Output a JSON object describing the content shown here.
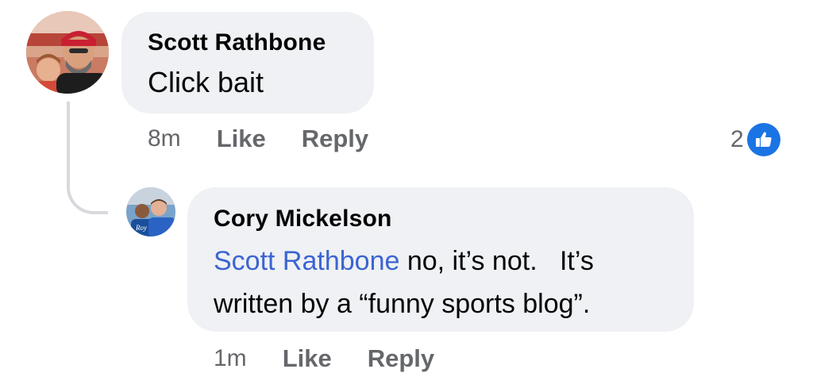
{
  "comments": [
    {
      "author": "Scott Rathbone",
      "text": "Click bait",
      "time": "8m",
      "like_label": "Like",
      "reply_label": "Reply",
      "reaction_count": "2",
      "reaction_icon": "thumbs-up-icon",
      "avatar": "profile-photo-scott-rathbone"
    },
    {
      "author": "Cory Mickelson",
      "mention": "Scott Rathbone",
      "text_line1": " no, it’s not.   It’s",
      "text_line2": "written by a “funny sports blog”.",
      "time": "1m",
      "like_label": "Like",
      "reply_label": "Reply",
      "avatar": "profile-photo-cory-mickelson"
    }
  ],
  "colors": {
    "bubble": "#eff1f4",
    "text": "#050505",
    "meta": "#65676b",
    "mention": "#3c64d1",
    "like_badge": "#1b74e4"
  }
}
